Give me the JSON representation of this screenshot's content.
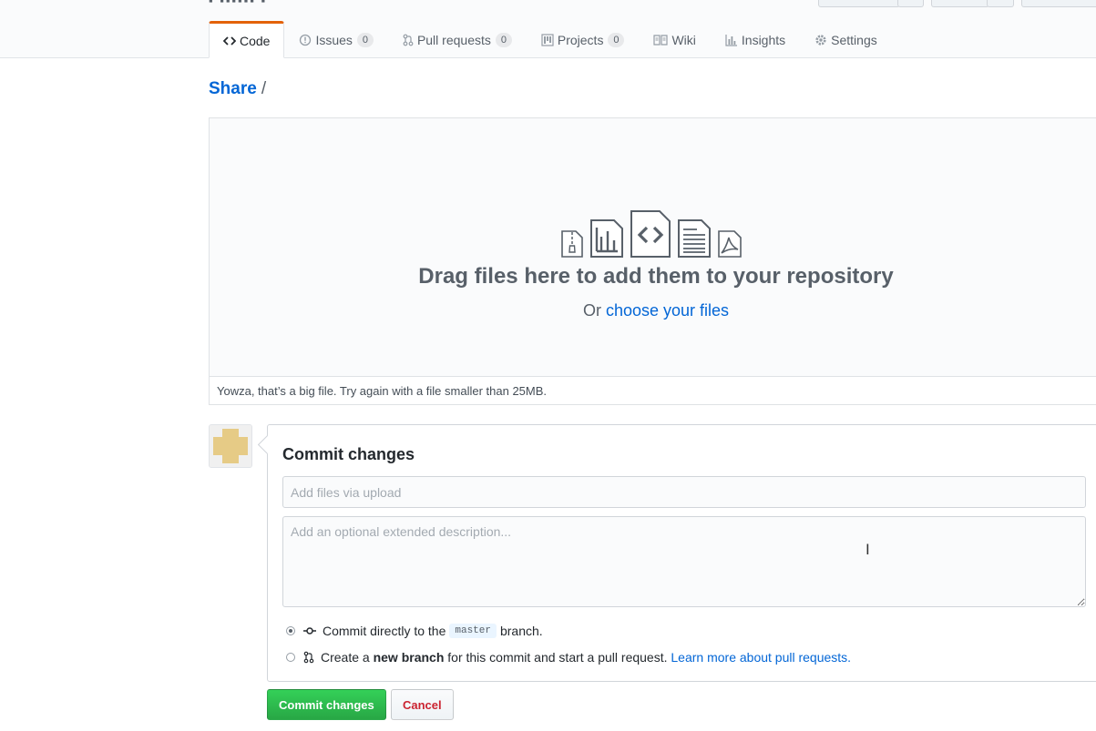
{
  "tabs": [
    {
      "label": "Code",
      "icon": "code-icon",
      "selected": true
    },
    {
      "label": "Issues",
      "icon": "issue-icon",
      "count": "0"
    },
    {
      "label": "Pull requests",
      "icon": "pull-request-icon",
      "count": "0"
    },
    {
      "label": "Projects",
      "icon": "project-icon",
      "count": "0"
    },
    {
      "label": "Wiki",
      "icon": "book-icon"
    },
    {
      "label": "Insights",
      "icon": "graph-icon"
    },
    {
      "label": "Settings",
      "icon": "gear-icon"
    }
  ],
  "breadcrumb": {
    "repo": "Share",
    "separator": "/"
  },
  "dropzone": {
    "title": "Drag files here to add them to your repository",
    "prefix": "Or",
    "link": "choose your files",
    "error": "Yowza, that’s a big file. Try again with a file smaller than 25MB."
  },
  "commit": {
    "title": "Commit changes",
    "summary_placeholder": "Add files via upload",
    "description_placeholder": "Add an optional extended description...",
    "option_direct_prefix": "Commit directly to the",
    "branch": "master",
    "option_direct_suffix": "branch.",
    "option_new_prefix": "Create a",
    "option_new_bold": "new branch",
    "option_new_suffix": "for this commit and start a pull request.",
    "learn_more": "Learn more about pull requests.",
    "selected_option": "direct"
  },
  "buttons": {
    "commit": "Commit changes",
    "cancel": "Cancel"
  },
  "colors": {
    "accent": "#0366d6",
    "tab_active": "#e36209",
    "commit_button": "#28a745",
    "cancel_text": "#cb2431"
  }
}
